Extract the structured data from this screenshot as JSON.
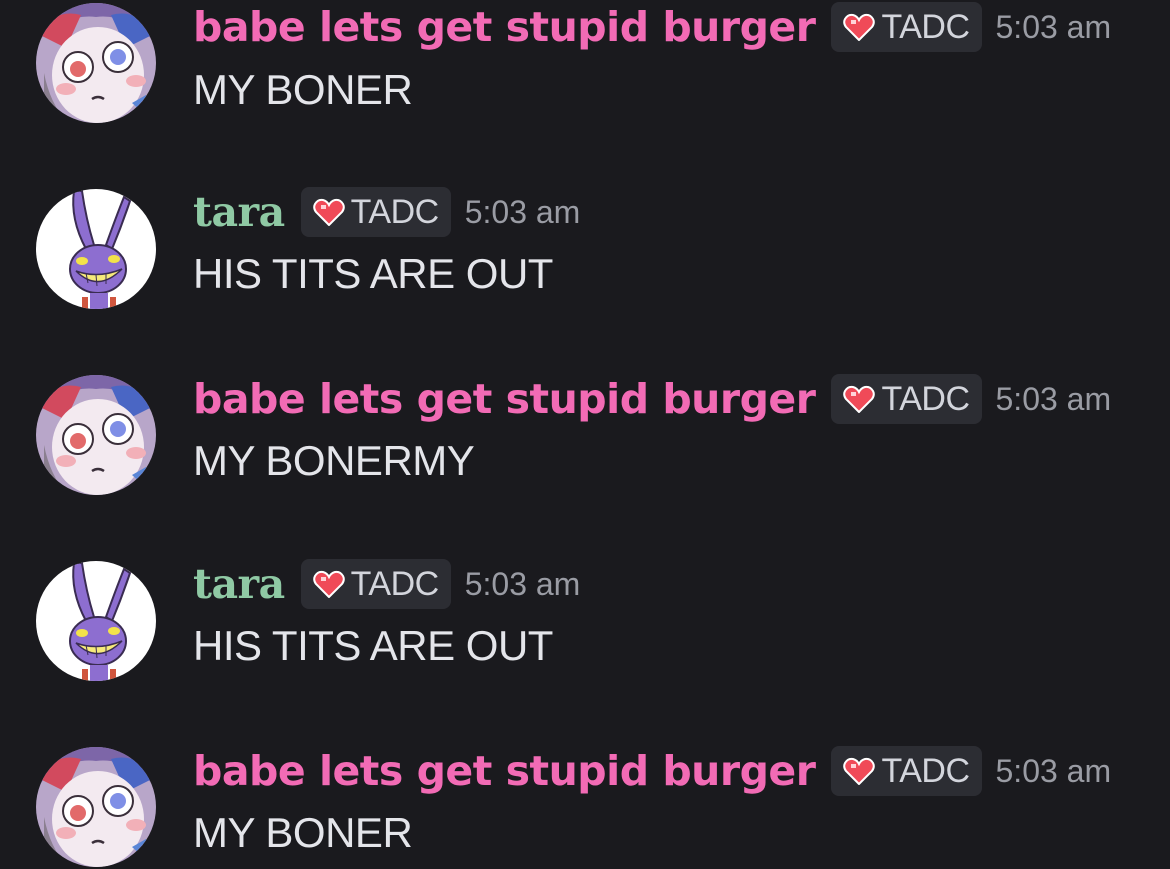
{
  "colors": {
    "background": "#1a1a1e",
    "username_pink": "#f26bb5",
    "username_green": "#8fc9a4",
    "tag_background": "#2c2d33",
    "tag_text": "#d3d5dc",
    "timestamp": "#9a9ca4",
    "message_text": "#e4e5ea"
  },
  "messages": [
    {
      "username": "babe lets get stupid burger",
      "tag_icon": "heart-icon",
      "tag": "TADC",
      "timestamp": "5:03 am",
      "text": "MY BONER",
      "avatar": "pomni-avatar"
    },
    {
      "username": "tara",
      "tag_icon": "heart-icon",
      "tag": "TADC",
      "timestamp": "5:03 am",
      "text": "HIS TITS ARE OUT",
      "avatar": "jax-avatar"
    },
    {
      "username": "babe lets get stupid burger",
      "tag_icon": "heart-icon",
      "tag": "TADC",
      "timestamp": "5:03 am",
      "text": "MY BONERMY",
      "avatar": "pomni-avatar"
    },
    {
      "username": "tara",
      "tag_icon": "heart-icon",
      "tag": "TADC",
      "timestamp": "5:03 am",
      "text": "HIS TITS ARE OUT",
      "avatar": "jax-avatar"
    },
    {
      "username": "babe lets get stupid burger",
      "tag_icon": "heart-icon",
      "tag": "TADC",
      "timestamp": "5:03 am",
      "text": "MY BONER",
      "avatar": "pomni-avatar"
    }
  ]
}
